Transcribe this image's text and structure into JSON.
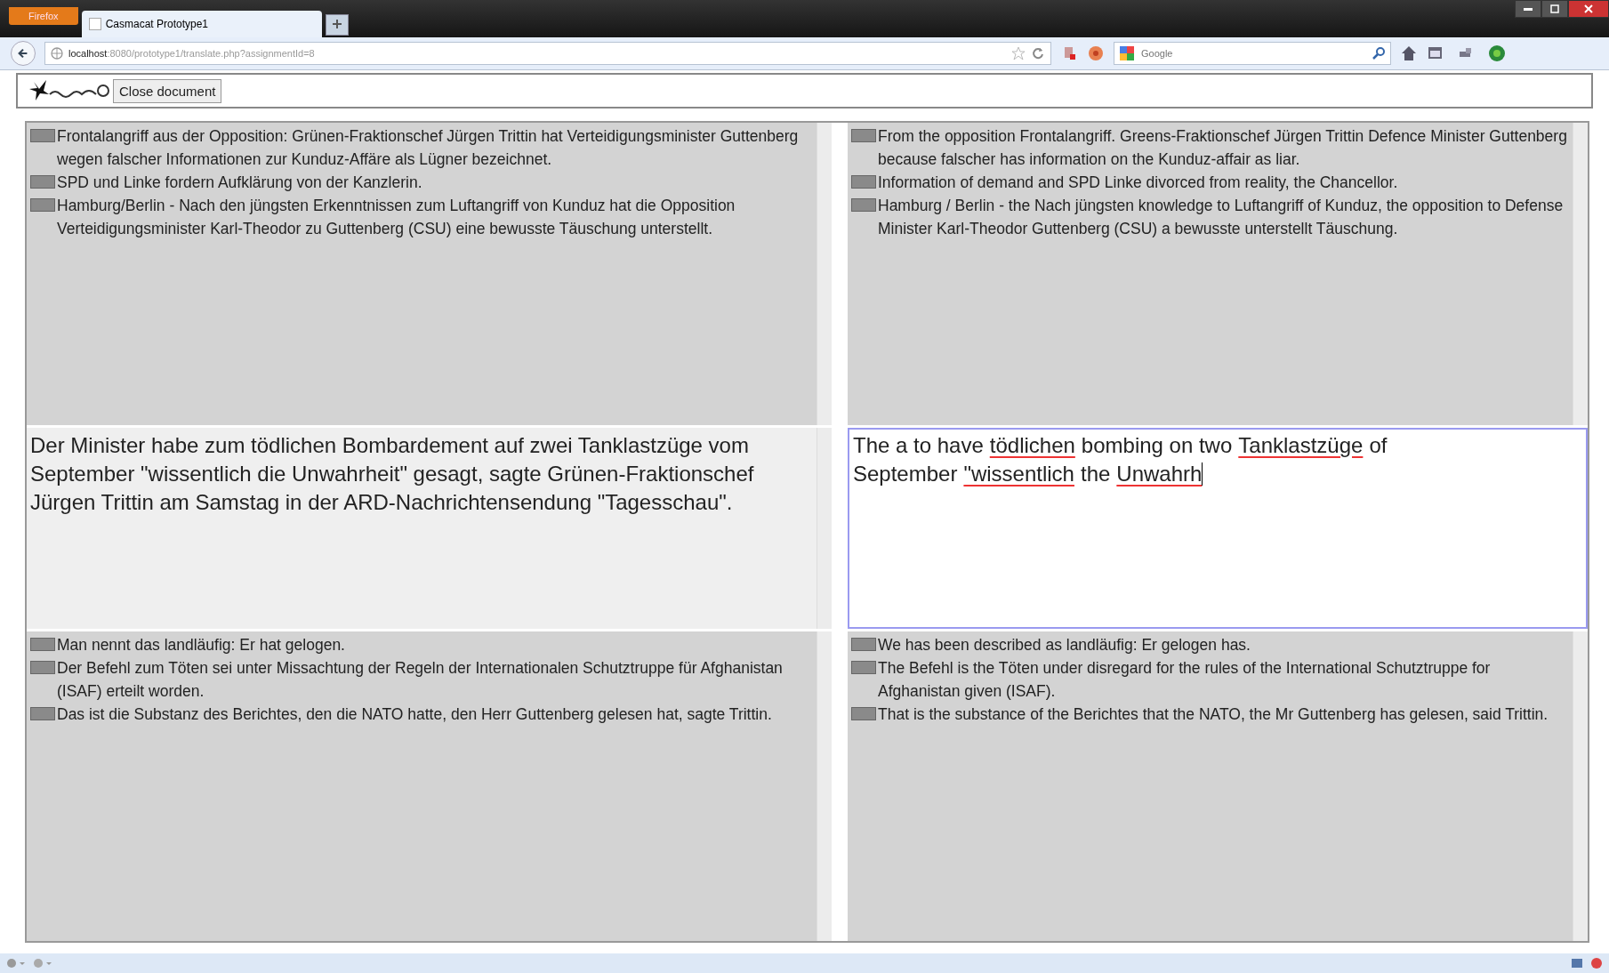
{
  "browser": {
    "menu_button": "Firefox",
    "tab_title": "Casmacat Prototype1",
    "url_host": "localhost",
    "url_path": ":8080/prototype1/translate.php?assignmentId=8",
    "search_placeholder": "Google"
  },
  "app": {
    "close_button": "Close document"
  },
  "rows": [
    {
      "kind": "context",
      "source": [
        "Frontalangriff aus der Opposition: Grünen-Fraktionschef Jürgen Trittin hat Verteidigungsminister Guttenberg wegen falscher Informationen zur Kunduz-Affäre als Lügner bezeichnet.",
        "SPD und Linke fordern Aufklärung von der Kanzlerin.",
        "Hamburg/Berlin - Nach den jüngsten Erkenntnissen zum Luftangriff von Kunduz hat die Opposition Verteidigungsminister Karl-Theodor zu Guttenberg (CSU) eine bewusste Täuschung unterstellt."
      ],
      "target": [
        "From the opposition Frontalangriff. Greens-Fraktionschef Jürgen Trittin Defence Minister Guttenberg because falscher has information on the Kunduz-affair as liar.",
        "Information of demand and SPD Linke divorced from reality, the Chancellor.",
        "Hamburg / Berlin - the Nach jüngsten knowledge to Luftangriff of Kunduz, the opposition to Defense Minister Karl-Theodor Guttenberg (CSU) a bewusste unterstellt Täuschung."
      ]
    },
    {
      "kind": "active",
      "source": "Der Minister habe zum tödlichen Bombardement auf zwei Tanklastzüge vom September \"wissentlich die Unwahrheit\" gesagt, sagte Grünen-Fraktionschef Jürgen Trittin am Samstag in der ARD-Nachrichtensendung \"Tagesschau\".",
      "target_words": [
        {
          "text": "The a to have",
          "misspelled": false
        },
        {
          "text": "tödlichen",
          "misspelled": true
        },
        {
          "text": "bombing on two",
          "misspelled": false
        },
        {
          "text": "Tanklastzüge",
          "misspelled": true
        },
        {
          "text": "of September",
          "misspelled": false
        },
        {
          "text": "\"wissentlich",
          "misspelled": true
        },
        {
          "text": "the",
          "misspelled": false
        },
        {
          "text": "Unwahrh",
          "misspelled": true
        }
      ]
    },
    {
      "kind": "context",
      "source": [
        "Man nennt das landläufig: Er hat gelogen.",
        "Der Befehl zum Töten sei unter Missachtung der Regeln der Internationalen Schutztruppe für Afghanistan (ISAF) erteilt worden.",
        "Das ist die Substanz des Berichtes, den die NATO hatte, den Herr Guttenberg gelesen hat, sagte Trittin."
      ],
      "target": [
        "We has been described as landläufig: Er gelogen has.",
        "The Befehl is the Töten under disregard for the rules of the International Schutztruppe for Afghanistan given (ISAF).",
        "That is the substance of the Berichtes that the NATO, the Mr Guttenberg has gelesen, said Trittin."
      ]
    }
  ]
}
